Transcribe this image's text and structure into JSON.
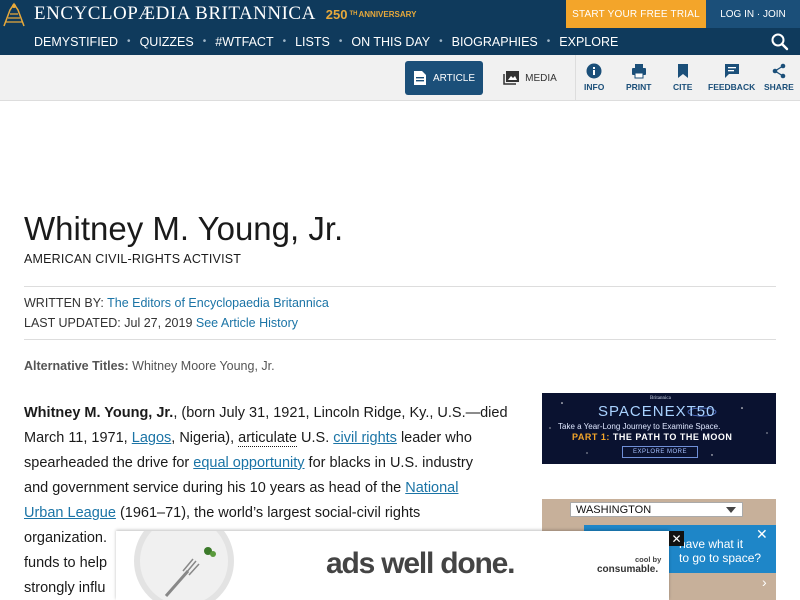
{
  "header": {
    "brand": "ENCYCLOPÆDIA BRITANNICA",
    "anniversary_num": "250",
    "anniversary_sup": "TH",
    "anniversary_label": "ANNIVERSARY",
    "cta_label": "START YOUR FREE TRIAL",
    "login_label": "LOG IN · JOIN"
  },
  "nav": {
    "items": [
      "DEMYSTIFIED",
      "QUIZZES",
      "#WTFACT",
      "LISTS",
      "ON THIS DAY",
      "BIOGRAPHIES",
      "EXPLORE"
    ],
    "separator": "•"
  },
  "toolbar": {
    "article_label": "ARTICLE",
    "media_label": "MEDIA",
    "tools": [
      "INFO",
      "PRINT",
      "CITE",
      "FEEDBACK",
      "SHARE"
    ]
  },
  "article": {
    "title": "Whitney M. Young, Jr.",
    "subtitle": "AMERICAN CIVIL-RIGHTS ACTIVIST",
    "written_by_label": "WRITTEN BY:",
    "written_by": "The Editors of Encyclopaedia Britannica",
    "updated_label": "LAST UPDATED:",
    "updated_date": "Jul 27, 2019",
    "history_link": "See Article History",
    "alt_label": "Alternative Titles:",
    "alt_value": "Whitney Moore Young, Jr.",
    "p1_bold": "Whitney M. Young, Jr.",
    "p1_a": ", (born July 31, 1921, Lincoln Ridge, Ky., U.S.—died",
    "p2_a": "March 11, 1971, ",
    "p2_link": "Lagos",
    "p2_b": ", Nigeria), ",
    "p2_dotted": "articulate",
    "p2_c": " U.S. ",
    "p2_link2": "civil rights",
    "p2_d": " leader who",
    "p3_a": "spearheaded the drive for ",
    "p3_link": "equal opportunity",
    "p3_b": " for blacks in U.S. industry",
    "p4_a": "and government service during his 10 years as head of the ",
    "p4_link": "National",
    "p5_link": "Urban League",
    "p5_a": " (1961–71), the world’s largest social-civil rights",
    "p6_a": "organization.",
    "p7_a": "funds to help",
    "p8_a": "strongly influ"
  },
  "space_ad": {
    "brand": "Britannica",
    "headline": "SPACENEXT50",
    "tagline": "Take a Year-Long Journey to Examine Space.",
    "part_label": "PART 1:",
    "part_title": "THE PATH TO THE MOON",
    "button": "EXPLORE MORE"
  },
  "wash_ad": {
    "select_value": "WASHINGTON",
    "question_line1": "have what it",
    "question_line2": "to go to space?"
  },
  "bottom_ad": {
    "slogan": "ads well done.",
    "cool_by": "cool by",
    "consumable": "consumable."
  }
}
